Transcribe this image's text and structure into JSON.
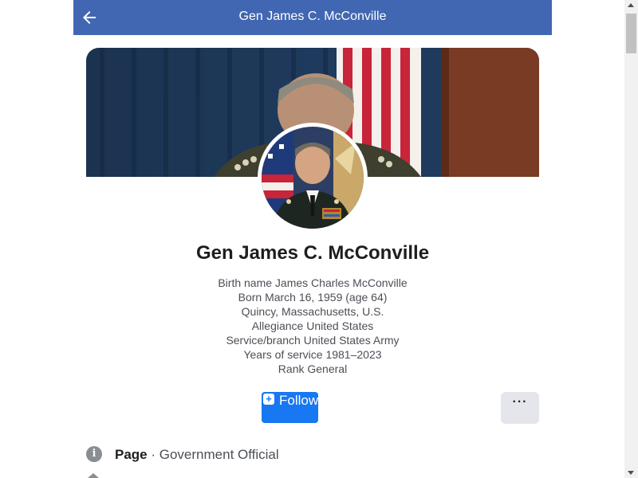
{
  "header": {
    "title": "Gen James C. McConville",
    "back_icon": "arrow-left-icon",
    "background": "#4267b2"
  },
  "profile": {
    "name": "Gen James C. McConville",
    "bio": [
      "Birth name James Charles McConville",
      "Born March 16, 1959 (age 64)",
      "Quincy, Massachusetts, U.S.",
      "Allegiance United States",
      "Service/branch United States Army",
      "Years of service 1981–2023",
      "Rank General"
    ]
  },
  "actions": {
    "follow_label": "Follow",
    "follow_icon": "plus-icon",
    "more_label": "···",
    "follow_color": "#1877f2"
  },
  "info": {
    "icon": "info-icon",
    "page_label": "Page",
    "separator": " · ",
    "category": "Government Official"
  }
}
